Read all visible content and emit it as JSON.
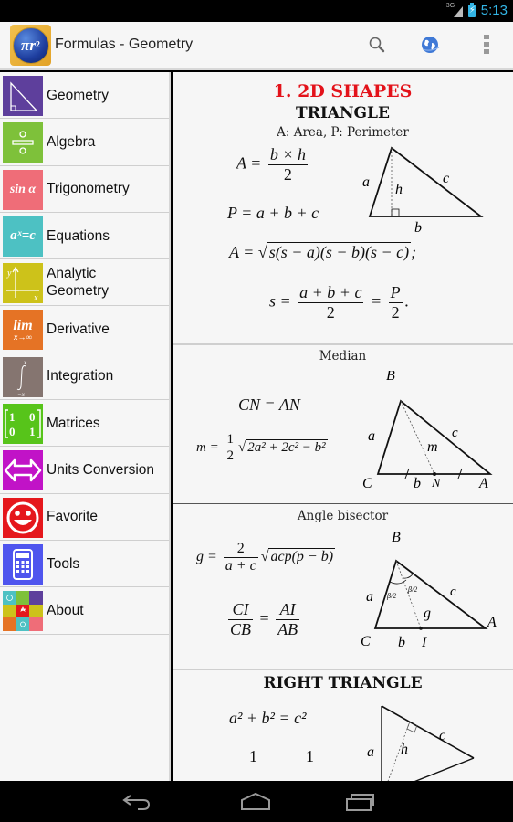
{
  "status_bar": {
    "network": "3G",
    "time": "5:13",
    "accent": "#33b5e5"
  },
  "action_bar": {
    "title": "Formulas - Geometry",
    "app_icon_text": "πr",
    "app_icon_sup": "2",
    "actions": [
      {
        "name": "search-icon",
        "label": "Search"
      },
      {
        "name": "globe-icon",
        "label": "Language"
      },
      {
        "name": "overflow-menu-icon",
        "label": "More options"
      }
    ]
  },
  "sidebar": {
    "items": [
      {
        "label": "Geometry",
        "icon": "right-triangle-icon",
        "color": "#5e3f9c"
      },
      {
        "label": "Algebra",
        "icon": "division-icon",
        "color": "#7ec13a"
      },
      {
        "label": "Trigonometry",
        "icon": "sin-alpha-icon",
        "icon_text": "sin α",
        "color": "#ef6d78"
      },
      {
        "label": "Equations",
        "icon": "equation-icon",
        "icon_text": "aˣ=c",
        "color": "#4dc1c3"
      },
      {
        "label": "Analytic",
        "label2": "Geometry",
        "icon": "axes-icon",
        "color": "#cdc21a"
      },
      {
        "label": "Derivative",
        "icon": "limit-icon",
        "icon_text": "lim",
        "icon_sub": "x→∞",
        "color": "#e57325"
      },
      {
        "label": "Integration",
        "icon": "integral-icon",
        "color": "#857570"
      },
      {
        "label": "Matrices",
        "icon": "matrix-icon",
        "color": "#57c41a"
      },
      {
        "label": "Units Conversion",
        "icon": "double-arrow-icon",
        "color": "#c113c7"
      },
      {
        "label": "Favorite",
        "icon": "smiley-icon",
        "color": "#e5171c"
      },
      {
        "label": "Tools",
        "icon": "calculator-icon",
        "color": "#4f55ee"
      },
      {
        "label": "About",
        "icon": "mosaic-icon",
        "color": "#4dc1c3"
      }
    ]
  },
  "content": {
    "section_title": "1. 2D SHAPES",
    "triangle": {
      "title": "TRIANGLE",
      "subtitle": "A: Area, P: Perimeter",
      "area_lhs": "A =",
      "area_num": "b × h",
      "area_den": "2",
      "perimeter": "P = a + b + c",
      "heron_lhs": "A =",
      "heron_rad": "s(s − a)(s − b)(s − c)",
      "heron_tail": ";",
      "s_lhs": "s =",
      "s_num": "a + b + c",
      "s_den": "2",
      "s_eq": "=",
      "s_num2": "P",
      "s_den2": "2",
      "s_tail": ".",
      "diagram_labels": {
        "a": "a",
        "b": "b",
        "c": "c",
        "h": "h"
      }
    },
    "median": {
      "heading": "Median",
      "eq1": "CN = AN",
      "m_lhs": "m =",
      "m_num": "1",
      "m_den": "2",
      "m_rad": "2a² + 2c² − b²",
      "diagram_labels": {
        "B": "B",
        "C": "C",
        "A": "A",
        "N": "N",
        "a": "a",
        "b": "b",
        "c": "c",
        "m": "m"
      }
    },
    "bisector": {
      "heading": "Angle bisector",
      "g_lhs": "g =",
      "g_num": "2",
      "g_den": "a + c",
      "g_rad": "acp(p − b)",
      "r_num1": "CI",
      "r_den1": "CB",
      "r_eq": "=",
      "r_num2": "AI",
      "r_den2": "AB",
      "diagram_labels": {
        "B": "B",
        "C": "C",
        "A": "A",
        "I": "I",
        "a": "a",
        "b": "b",
        "c": "c",
        "g": "g",
        "half1": "β/2",
        "half2": "β/2"
      }
    },
    "right_triangle": {
      "title": "RIGHT TRIANGLE",
      "pythagoras": "a² + b² = c²",
      "partial_1": "1",
      "partial_2": "1",
      "diagram_labels": {
        "a": "a",
        "c": "c",
        "h": "h"
      }
    }
  },
  "nav_bar": {
    "buttons": [
      "Back",
      "Home",
      "Recent apps"
    ]
  }
}
